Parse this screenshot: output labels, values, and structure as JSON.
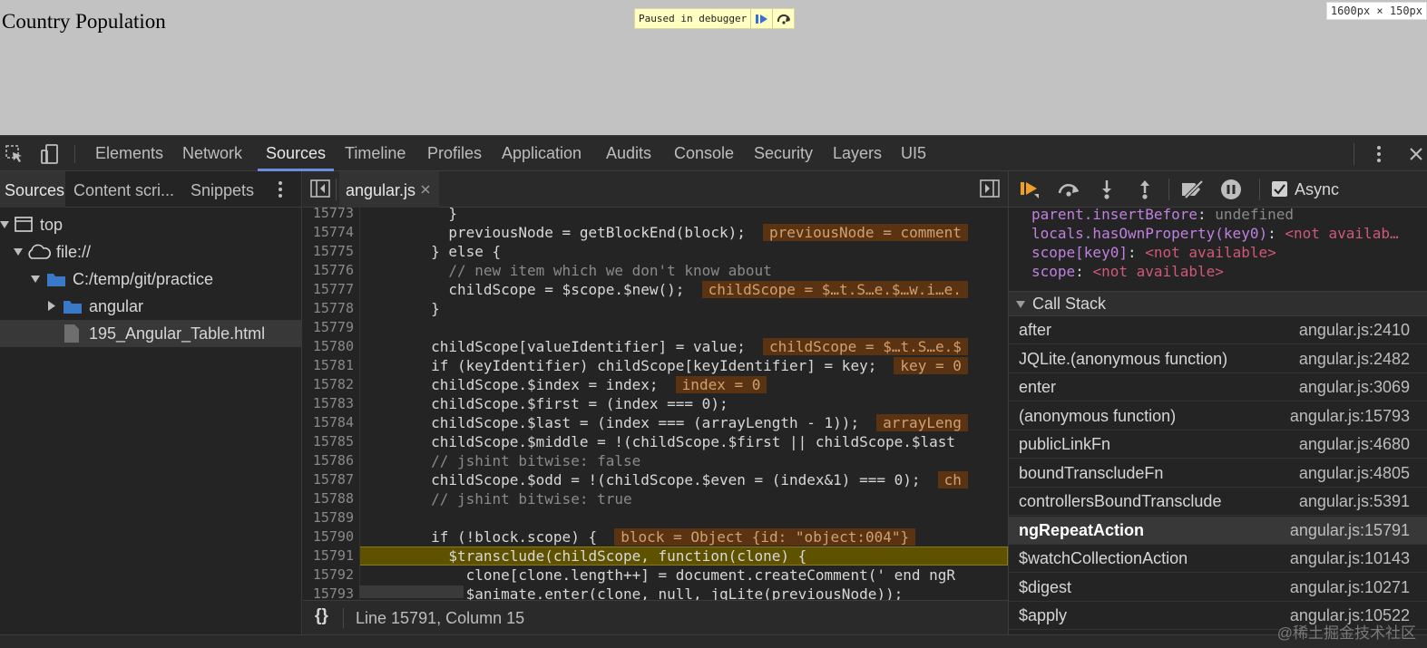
{
  "viewport": {
    "heading": "Country Population",
    "paused_label": "Paused in debugger",
    "dimensions": "1600px × 150px"
  },
  "main_tabs": [
    "Elements",
    "Network",
    "Sources",
    "Timeline",
    "Profiles",
    "Application",
    "Audits",
    "Console",
    "Security",
    "Layers",
    "UI5"
  ],
  "active_main_tab": "Sources",
  "navigator": {
    "tabs": [
      "Sources",
      "Content scri...",
      "Snippets"
    ],
    "tree": {
      "top": "top",
      "origin": "file://",
      "folder": "C:/temp/git/practice",
      "subfolder": "angular",
      "file": "195_Angular_Table.html"
    }
  },
  "editor": {
    "file_tab": "angular.js",
    "lines": [
      {
        "n": "15773",
        "code": "          }"
      },
      {
        "n": "15774",
        "code": "          previousNode = getBlockEnd(block);",
        "val": "previousNode = comment"
      },
      {
        "n": "15775",
        "code": "        } else {"
      },
      {
        "n": "15776",
        "code": "          // new item which we don't know about",
        "comment": true
      },
      {
        "n": "15777",
        "code": "          childScope = $scope.$new();",
        "val": "childScope = $…t.S…e.$…w.i…e."
      },
      {
        "n": "15778",
        "code": "        }"
      },
      {
        "n": "15779",
        "code": ""
      },
      {
        "n": "15780",
        "code": "        childScope[valueIdentifier] = value;",
        "val": "childScope = $…t.S…e.$"
      },
      {
        "n": "15781",
        "code": "        if (keyIdentifier) childScope[keyIdentifier] = key;",
        "val": "key = 0"
      },
      {
        "n": "15782",
        "code": "        childScope.$index = index;",
        "val": "index = 0"
      },
      {
        "n": "15783",
        "code": "        childScope.$first = (index === 0);"
      },
      {
        "n": "15784",
        "code": "        childScope.$last = (index === (arrayLength - 1));",
        "val": "arrayLeng"
      },
      {
        "n": "15785",
        "code": "        childScope.$middle = !(childScope.$first || childScope.$last"
      },
      {
        "n": "15786",
        "code": "        // jshint bitwise: false",
        "comment": true
      },
      {
        "n": "15787",
        "code": "        childScope.$odd = !(childScope.$even = (index&1) === 0);",
        "val": "ch"
      },
      {
        "n": "15788",
        "code": "        // jshint bitwise: true",
        "comment": true
      },
      {
        "n": "15789",
        "code": ""
      },
      {
        "n": "15790",
        "code": "        if (!block.scope) {",
        "val": "block = Object {id: \"object:004\"}"
      },
      {
        "n": "15791",
        "code": "          $transclude(childScope, function(clone) {",
        "exec": true
      },
      {
        "n": "15792",
        "code": "            clone[clone.length++] = document.createComment(' end ngR"
      },
      {
        "n": "15793",
        "code": "            $animate.enter(clone, null, jqLite(previousNode));"
      }
    ],
    "status": "Line 15791, Column 15"
  },
  "debugger": {
    "async_label": "Async",
    "async_checked": true,
    "scope": [
      {
        "name": "parent.insertBefore",
        "value": "undefined",
        "kind": "undef"
      },
      {
        "name": "locals.hasOwnProperty(key0)",
        "value": "<not availab…",
        "kind": "na"
      },
      {
        "name": "scope[key0]",
        "value": "<not available>",
        "kind": "na"
      },
      {
        "name": "scope",
        "value": "<not available>",
        "kind": "na"
      }
    ],
    "call_stack_title": "Call Stack",
    "call_stack": [
      {
        "fn": "after",
        "loc": "angular.js:2410"
      },
      {
        "fn": "JQLite.(anonymous function)",
        "loc": "angular.js:2482"
      },
      {
        "fn": "enter",
        "loc": "angular.js:3069"
      },
      {
        "fn": "(anonymous function)",
        "loc": "angular.js:15793"
      },
      {
        "fn": "publicLinkFn",
        "loc": "angular.js:4680"
      },
      {
        "fn": "boundTranscludeFn",
        "loc": "angular.js:4805"
      },
      {
        "fn": "controllersBoundTransclude",
        "loc": "angular.js:5391"
      },
      {
        "fn": "ngRepeatAction",
        "loc": "angular.js:15791",
        "selected": true
      },
      {
        "fn": "$watchCollectionAction",
        "loc": "angular.js:10143"
      },
      {
        "fn": "$digest",
        "loc": "angular.js:10271"
      },
      {
        "fn": "$apply",
        "loc": "angular.js:10522"
      }
    ]
  },
  "watermark": "@稀土掘金技术社区",
  "colors": {
    "accent": "#6b8de0",
    "exec_line": "#5e5200",
    "inline_value_bg": "#5a3312",
    "folder": "#3a78c8"
  }
}
